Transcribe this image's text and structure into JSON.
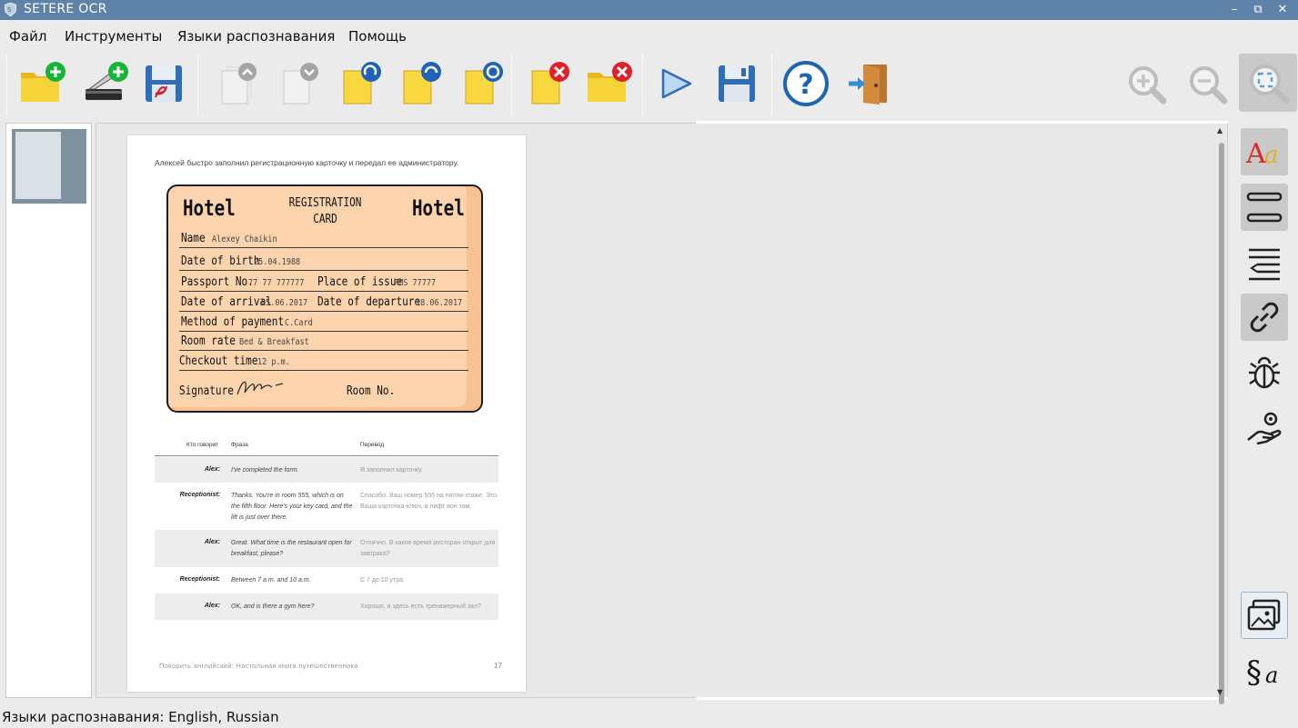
{
  "window": {
    "title": "SETERE OCR",
    "minimize": "–",
    "restore": "⧉",
    "close": "✕"
  },
  "menu": [
    "Файл",
    "Инструменты",
    "Языки распознавания",
    "Помощь"
  ],
  "toolbar": {
    "buttons": [
      "open-folder",
      "scan",
      "save-pdf",
      "move-page-up",
      "move-page-down",
      "rotate-left",
      "rotate-right",
      "rotate-page",
      "delete-page",
      "delete-all-pages",
      "recognize",
      "save",
      "help",
      "exit",
      "zoom-in",
      "zoom-out",
      "fit-to-window"
    ]
  },
  "document": {
    "intro": "Алексей быстро заполнил регистрационную карточку и передал ее администратору.",
    "card": {
      "hotel_left": "Hotel",
      "hotel_right": "Hotel",
      "title_line1": "REGISTRATION",
      "title_line2": "CARD",
      "name_label": "Name",
      "name_value": "Alexey Chaikin",
      "dob_label": "Date of birth",
      "dob_value": "25.04.1988",
      "passport_label": "Passport No.",
      "passport_value": "77 77 777777",
      "issue_label": "Place of issue",
      "issue_value": "FMS 77777",
      "arrival_label": "Date of arrival",
      "arrival_value": "05.06.2017",
      "departure_label": "Date of departure",
      "departure_value": "18.06.2017",
      "payment_label": "Method of payment",
      "payment_value": "C.Card",
      "rate_label": "Room rate",
      "rate_value": "Bed & Breakfast",
      "checkout_label": "Checkout time",
      "checkout_value": "12 p.m.",
      "signature_label": "Signature",
      "room_label": "Room No."
    },
    "dialog_headers": {
      "speaker": "Кто говорит",
      "phrase": "Фраза",
      "translation": "Перевод"
    },
    "dialog": [
      {
        "speaker": "Alex:",
        "en": "I've completed the form.",
        "ru": "Я заполнил карточку."
      },
      {
        "speaker": "Receptionist:",
        "en": "Thanks. You're in room 555, which is on the fifth floor. Here's your key card, and the lift is just over there.",
        "ru": "Спасибо. Ваш номер 555 на пятом этаже. Это Ваша карточка-ключ, а лифт вон там."
      },
      {
        "speaker": "Alex:",
        "en": "Great. What time is the restaurant open for breakfast, please?",
        "ru": "Отлично. В какое время ресторан открыт для завтрака?"
      },
      {
        "speaker": "Receptionist:",
        "en": "Between 7 a.m. and 10 a.m.",
        "ru": "С 7 до 10 утра."
      },
      {
        "speaker": "Alex:",
        "en": "OK, and is there a gym here?",
        "ru": "Хорошо, а здесь есть тренажерный зал?"
      }
    ],
    "footer": "Покорить английский: Настольная книга путешественника",
    "page_number": "17"
  },
  "side_tools": [
    "fonts",
    "layout",
    "paragraph",
    "link",
    "debug",
    "settings",
    "image-mode",
    "text-format"
  ],
  "status": "Языки распознавания: English, Russian",
  "colors": {
    "titlebar": "#5f83a8",
    "card": "#fbd3ad",
    "folder": "#f7d33a",
    "help": "#1f63b5"
  }
}
